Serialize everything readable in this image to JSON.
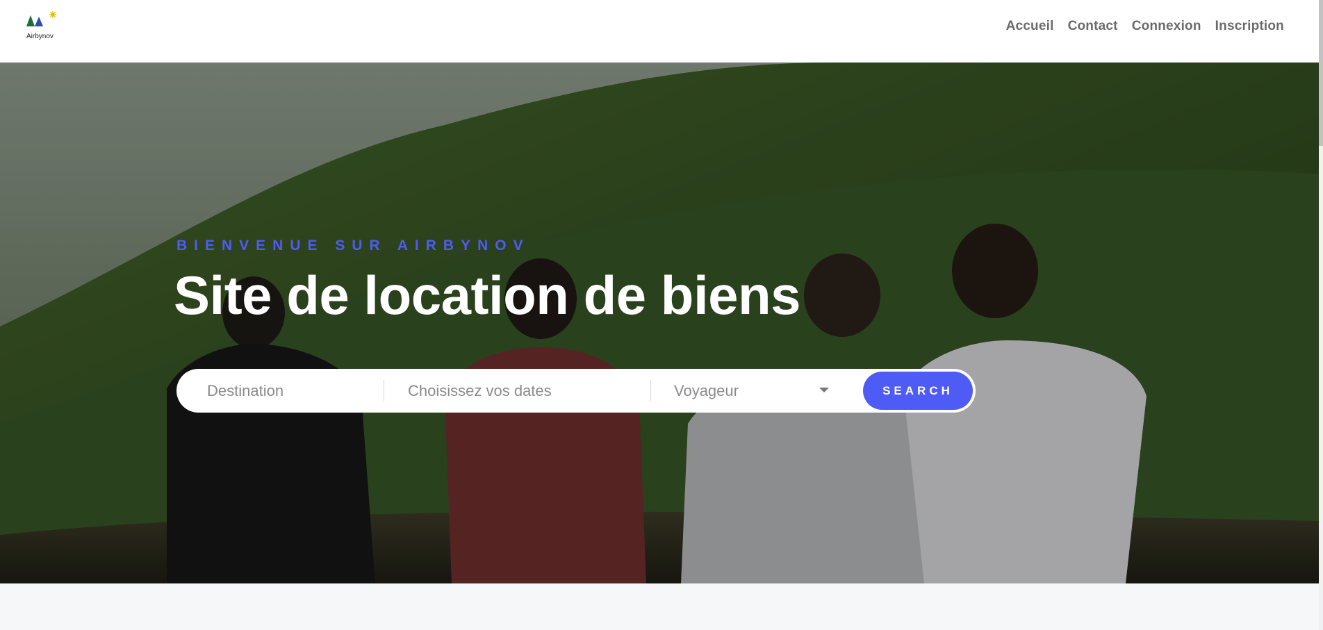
{
  "brand": {
    "name": "Airbynov"
  },
  "nav": {
    "items": [
      {
        "label": "Accueil"
      },
      {
        "label": "Contact"
      },
      {
        "label": "Connexion"
      },
      {
        "label": "Inscription"
      }
    ]
  },
  "hero": {
    "eyebrow": "BIENVENUE SUR AIRBYNOV",
    "title": "Site de location de biens"
  },
  "search": {
    "destination_placeholder": "Destination",
    "dates_placeholder": "Choisissez vos dates",
    "travellers_selected": "Voyageur",
    "button_label": "SEARCH"
  },
  "colors": {
    "accent": "#4f5bf5",
    "nav_text": "#6b6b6b",
    "page_bg": "#f6f7f9"
  }
}
